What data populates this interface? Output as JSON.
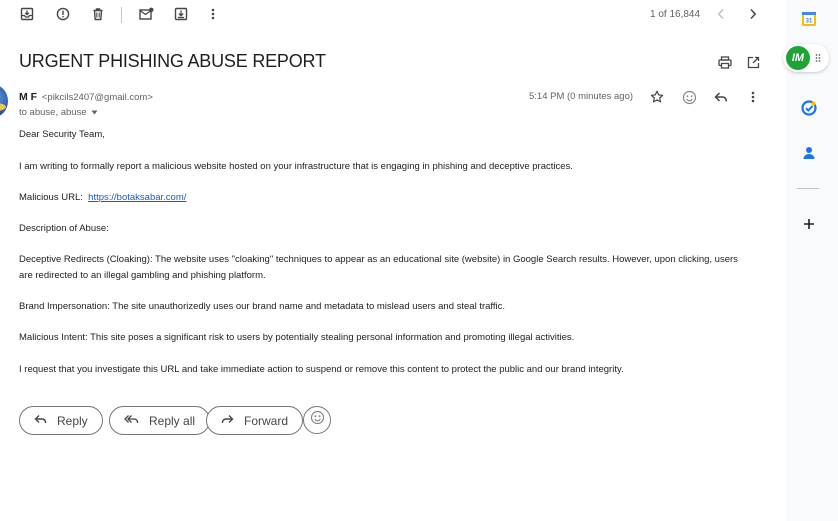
{
  "toolbar": {
    "icons": [
      "archive-icon",
      "report-spam-icon",
      "delete-icon",
      "mark-unread-icon",
      "move-to-icon",
      "more-vert-icon"
    ],
    "pager_text": "1 of 16,844"
  },
  "email": {
    "subject": "URGENT PHISHING ABUSE REPORT",
    "sender_name": "M F",
    "sender_email": "<pikcils2407@gmail.com>",
    "to_line": "to abuse, abuse",
    "time": "5:14 PM (0 minutes ago)",
    "greeting": "Dear Security Team,",
    "p1": "I am writing to formally report a malicious website hosted on your infrastructure that is engaging in phishing and deceptive practices.",
    "url_label": "Malicious URL:",
    "url": "https://botaksabar.com/",
    "desc_heading": "Description of Abuse:",
    "p2": "Deceptive Redirects (Cloaking): The website uses \"cloaking\" techniques to appear as an educational site (website) in Google Search results. However, upon clicking, users are redirected to an illegal gambling and phishing platform.",
    "p3": "Brand Impersonation: The site unauthorizedly uses our brand name and metadata to mislead users and steal traffic.",
    "p4": "Malicious Intent: This site poses a significant risk to users by potentially stealing personal information and promoting illegal activities.",
    "p5": "I request that you investigate this URL and take immediate action to suspend or remove this content to protect the public and our brand integrity."
  },
  "actions": {
    "reply": "Reply",
    "reply_all": "Reply all",
    "forward": "Forward"
  },
  "right_rail": {
    "extension_badge": "IM",
    "icons": [
      "calendar-icon",
      "tasks-icon",
      "contacts-icon",
      "add-icon"
    ],
    "calendar_day": "31"
  },
  "colors": {
    "link": "#1a57c2",
    "extension_green": "#1fa336",
    "tasks_blue": "#1a73e8"
  }
}
